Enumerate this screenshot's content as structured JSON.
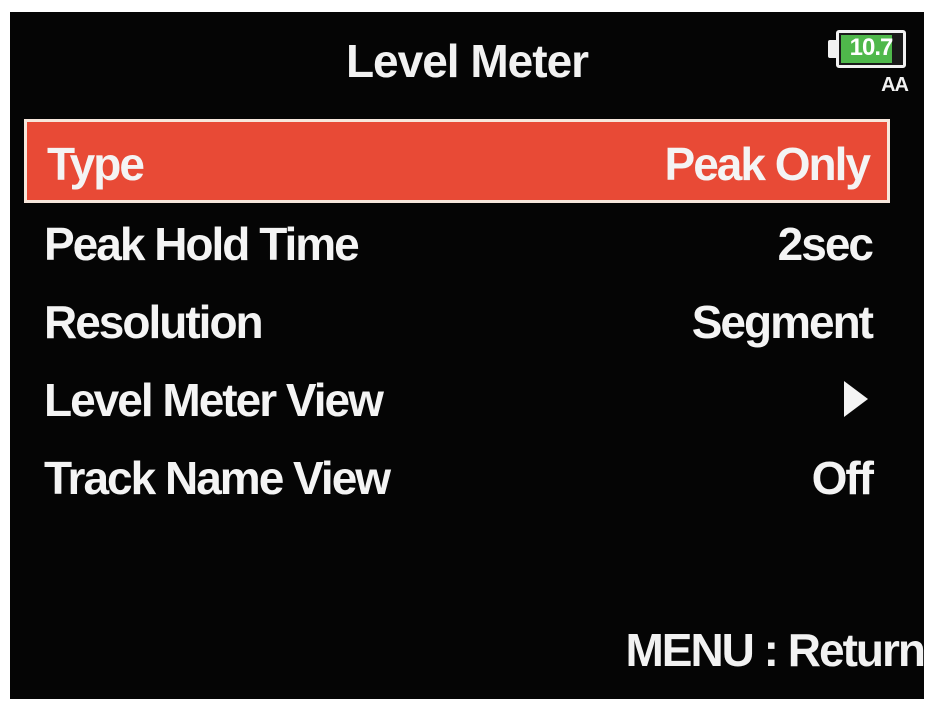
{
  "header": {
    "title": "Level Meter",
    "battery_voltage": "10.7",
    "battery_type": "AA",
    "battery_level": 0.85,
    "battery_color": "#4fb84b"
  },
  "menu": {
    "items": [
      {
        "label": "Type",
        "value": "Peak Only",
        "selected": true
      },
      {
        "label": "Peak Hold Time",
        "value": "2sec"
      },
      {
        "label": "Resolution",
        "value": "Segment"
      },
      {
        "label": "Level Meter View",
        "value": "",
        "icon": "chevron-right-icon"
      },
      {
        "label": "Track Name View",
        "value": "Off"
      }
    ]
  },
  "footer": {
    "hint": "MENU : Return"
  },
  "colors": {
    "highlight": "#e84a36",
    "background": "#050505",
    "text": "#f4f4f4"
  }
}
